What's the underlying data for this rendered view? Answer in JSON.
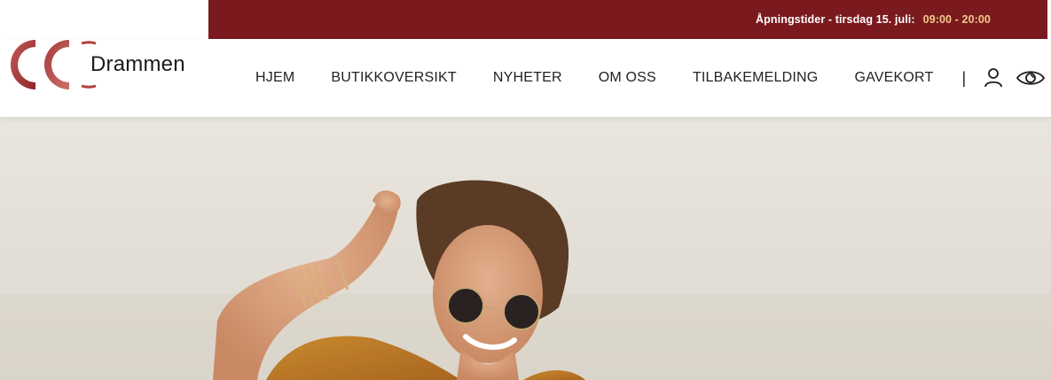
{
  "topbar": {
    "label": "Åpningstider - tirsdag 15. juli:",
    "hours": "09:00 - 20:00",
    "background": "#7a1a1f",
    "hours_color": "#f3c98a"
  },
  "logo": {
    "brand": "Drammen",
    "mark_color": "#b2403f"
  },
  "nav": {
    "items": [
      {
        "label": "HJEM"
      },
      {
        "label": "BUTIKKOVERSIKT"
      },
      {
        "label": "NYHETER"
      },
      {
        "label": "OM OSS"
      },
      {
        "label": "TILBAKEMELDING"
      },
      {
        "label": "GAVEKORT"
      }
    ],
    "separator": "|",
    "icons": [
      "user-icon",
      "eye-icon",
      "search-icon"
    ]
  },
  "hero": {
    "description_icon": "hero-photo"
  }
}
